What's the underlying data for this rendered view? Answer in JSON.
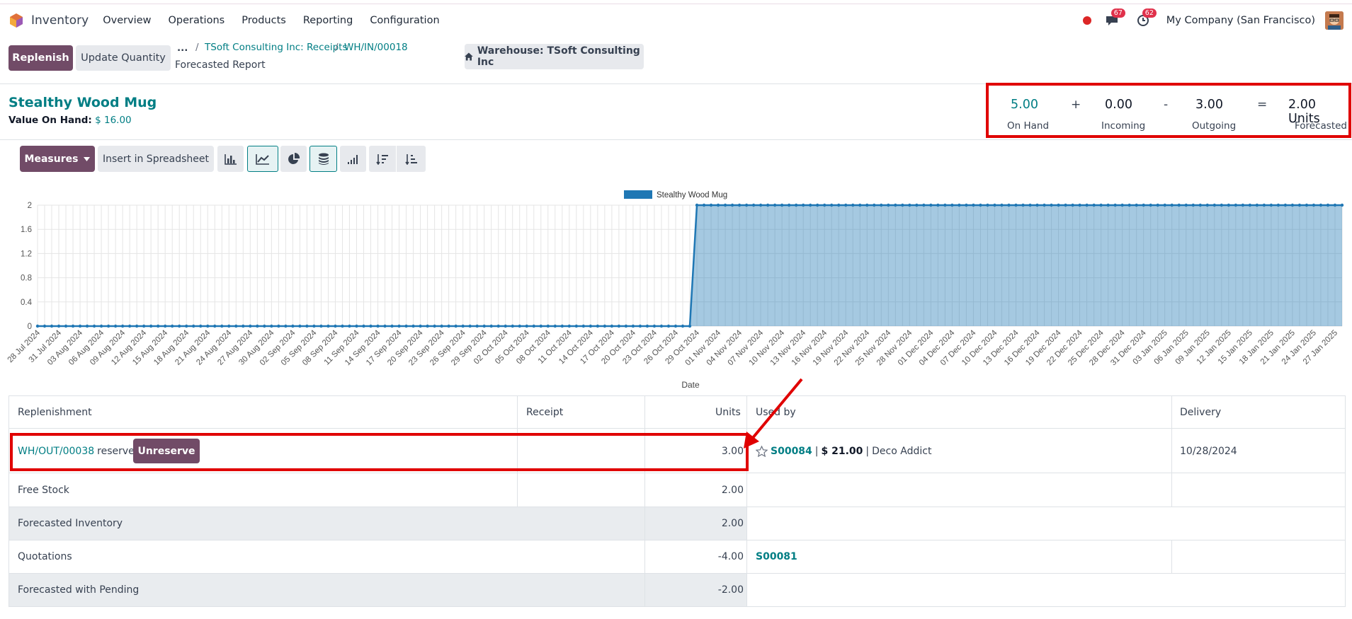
{
  "nav": {
    "app_name": "Inventory",
    "items": [
      "Overview",
      "Operations",
      "Products",
      "Reporting",
      "Configuration"
    ],
    "messages_badge": "67",
    "activities_badge": "62",
    "company": "My Company (San Francisco)"
  },
  "control": {
    "replenish_label": "Replenish",
    "update_qty_label": "Update Quantity",
    "breadcrumb_ellipsis": "...",
    "breadcrumb_1": "TSoft Consulting Inc: Receipts",
    "breadcrumb_2": "WH/IN/00018",
    "page_subtitle": "Forecasted Report",
    "warehouse_label": "Warehouse: TSoft Consulting Inc"
  },
  "product": {
    "name": "Stealthy Wood Mug",
    "value_label": "Value On Hand:",
    "value_amount": "$ 16.00"
  },
  "summary": {
    "on_hand": "5.00",
    "on_hand_label": "On Hand",
    "incoming": "0.00",
    "incoming_label": "Incoming",
    "outgoing": "3.00",
    "outgoing_label": "Outgoing",
    "forecasted": "2.00 Units",
    "forecasted_label": "Forecasted",
    "op_plus": "+",
    "op_minus": "-",
    "op_eq": "="
  },
  "toolbar": {
    "measures_label": "Measures",
    "spreadsheet_label": "Insert in Spreadsheet"
  },
  "chart_data": {
    "type": "area",
    "legend": "Stealthy Wood Mug",
    "xlabel": "Date",
    "ylabel": "",
    "ylim": [
      0,
      2
    ],
    "yticks": [
      "0",
      "0.4",
      "0.8",
      "1.2",
      "1.6",
      "2"
    ],
    "x_tick_labels": [
      "28 Jul 2024",
      "31 Jul 2024",
      "03 Aug 2024",
      "06 Aug 2024",
      "09 Aug 2024",
      "12 Aug 2024",
      "15 Aug 2024",
      "18 Aug 2024",
      "21 Aug 2024",
      "24 Aug 2024",
      "27 Aug 2024",
      "30 Aug 2024",
      "02 Sep 2024",
      "05 Sep 2024",
      "08 Sep 2024",
      "11 Sep 2024",
      "14 Sep 2024",
      "17 Sep 2024",
      "20 Sep 2024",
      "23 Sep 2024",
      "26 Sep 2024",
      "29 Sep 2024",
      "02 Oct 2024",
      "05 Oct 2024",
      "08 Oct 2024",
      "11 Oct 2024",
      "14 Oct 2024",
      "17 Oct 2024",
      "20 Oct 2024",
      "23 Oct 2024",
      "26 Oct 2024",
      "29 Oct 2024",
      "01 Nov 2024",
      "04 Nov 2024",
      "07 Nov 2024",
      "10 Nov 2024",
      "13 Nov 2024",
      "16 Nov 2024",
      "19 Nov 2024",
      "22 Nov 2024",
      "25 Nov 2024",
      "28 Nov 2024",
      "01 Dec 2024",
      "04 Dec 2024",
      "07 Dec 2024",
      "10 Dec 2024",
      "13 Dec 2024",
      "16 Dec 2024",
      "19 Dec 2024",
      "22 Dec 2024",
      "25 Dec 2024",
      "28 Dec 2024",
      "31 Dec 2024",
      "03 Jan 2025",
      "06 Jan 2025",
      "09 Jan 2025",
      "12 Jan 2025",
      "15 Jan 2025",
      "18 Jan 2025",
      "21 Jan 2025",
      "24 Jan 2025",
      "27 Jan 2025"
    ],
    "series": [
      {
        "name": "Stealthy Wood Mug",
        "color": "#1f77b4",
        "points": [
          {
            "x": "2024-07-28",
            "y": 0
          },
          {
            "x": "2024-10-28",
            "y": 0
          },
          {
            "x": "2024-10-29",
            "y": 2
          },
          {
            "x": "2025-01-28",
            "y": 2
          }
        ]
      }
    ],
    "grid": true,
    "legend_position": "top-center"
  },
  "table": {
    "headers": {
      "replenishment": "Replenishment",
      "receipt": "Receipt",
      "units": "Units",
      "used_by": "Used by",
      "delivery": "Delivery"
    },
    "row1": {
      "ref": "WH/OUT/00038",
      "status": "reserved",
      "unreserve_label": "Unreserve",
      "units": "3.00",
      "order": "S00084",
      "sep1": "|",
      "amount": "$ 21.00",
      "sep2": "|",
      "customer": "Deco Addict",
      "delivery": "10/28/2024"
    },
    "free_stock": {
      "label": "Free Stock",
      "units": "2.00"
    },
    "forecasted_inventory": {
      "label": "Forecasted Inventory",
      "units": "2.00"
    },
    "quotations": {
      "label": "Quotations",
      "units": "-4.00",
      "order": "S00081"
    },
    "forecasted_pending": {
      "label": "Forecasted with Pending",
      "units": "-2.00"
    }
  },
  "colors": {
    "brand": "#714b67",
    "link": "#017e84",
    "highlight": "#e00000",
    "series": "#1f77b4"
  }
}
